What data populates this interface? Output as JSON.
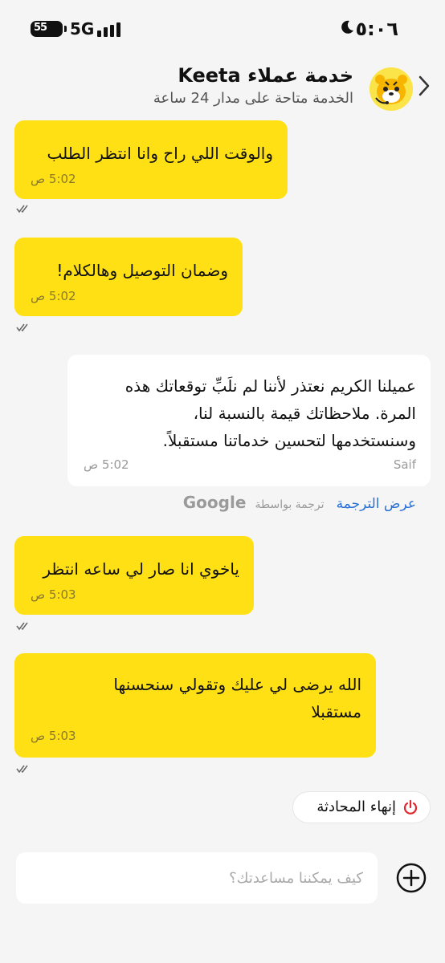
{
  "status_bar": {
    "time": "٥:٠٦",
    "battery": "55",
    "network": "5G"
  },
  "header": {
    "title": "خدمة عملاء Keeta",
    "subtitle": "الخدمة متاحة على مدار 24 ساعة"
  },
  "messages": [
    {
      "from": "user",
      "text": [
        "والوقت اللي راح وانا انتظر الطلب"
      ],
      "time": "5:02 ص"
    },
    {
      "from": "user",
      "text": [
        "وضمان التوصيل وهالكلام!"
      ],
      "time": "5:02 ص"
    },
    {
      "from": "agent",
      "text": [
        "عميلنا الكريم نعتذر لأننا لم نلَبِّ توقعاتك هذه",
        "المرة. ملاحظاتك قيمة بالنسبة لنا،",
        "وسنستخدمها لتحسين خدماتنا مستقبلاً."
      ],
      "time": "5:02 ص",
      "sender": "Saif"
    },
    {
      "from": "user",
      "text": [
        "ياخوي انا صار لي ساعه انتظر"
      ],
      "time": "5:03 ص"
    },
    {
      "from": "user",
      "text": [
        "الله يرضى لي عليك وتقولي سنحسنها",
        "مستقبلا"
      ],
      "time": "5:03 ص"
    }
  ],
  "translation": {
    "show_translation": "عرض الترجمة",
    "translated_by": "ترجمة بواسطة",
    "provider": "Google"
  },
  "end_chat_label": "إنهاء المحادثة",
  "input": {
    "placeholder": "كيف يمكننا مساعدتك؟"
  },
  "colors": {
    "user_bubble": "#ffe014",
    "agent_bubble": "#ffffff",
    "link": "#2a6fd6",
    "end_icon": "#e0282e"
  }
}
